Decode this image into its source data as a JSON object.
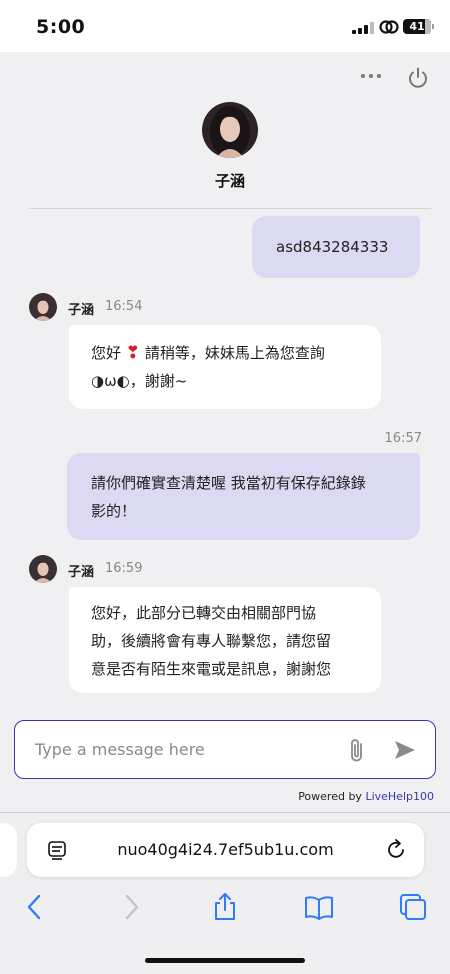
{
  "status_bar": {
    "time": "5:00",
    "battery": "41"
  },
  "chat": {
    "agent_name": "子涵",
    "messages": [
      {
        "direction": "out",
        "text": "asd843284333"
      },
      {
        "direction": "in",
        "sender": "子涵",
        "time": "16:54",
        "line1_before": "您好",
        "line1_after": "請稍等，妹妹馬上為您查詢",
        "line2": "◑ω◐，謝謝~"
      },
      {
        "direction": "out",
        "time": "16:57",
        "line1": "請你們確實查清楚喔 我當初有保存紀錄錄",
        "line2": "影的！"
      },
      {
        "direction": "in",
        "sender": "子涵",
        "time": "16:59",
        "line1": "您好，此部分已轉交由相關部門協",
        "line2": "助，後續將會有專人聯繫您，請您留",
        "line3": "意是否有陌生來電或是訊息，謝謝您"
      }
    ],
    "input_placeholder": "Type a message here",
    "powered_by_prefix": "Powered by ",
    "powered_by_brand": "LiveHelp100",
    "colors": {
      "accent": "#3b36a8",
      "outgoing_bubble": "#dcdaf2",
      "incoming_bubble": "#ffffff"
    }
  },
  "browser": {
    "url": "nuo40g4i24.7ef5ub1u.com"
  },
  "icons": [
    "signal-icon",
    "link-icon",
    "battery-icon",
    "more-icon",
    "power-icon",
    "heart-icon",
    "attach-icon",
    "send-icon",
    "reader-mode-icon",
    "reload-icon",
    "back-icon",
    "forward-icon",
    "share-icon",
    "bookmarks-icon",
    "tabs-icon"
  ]
}
